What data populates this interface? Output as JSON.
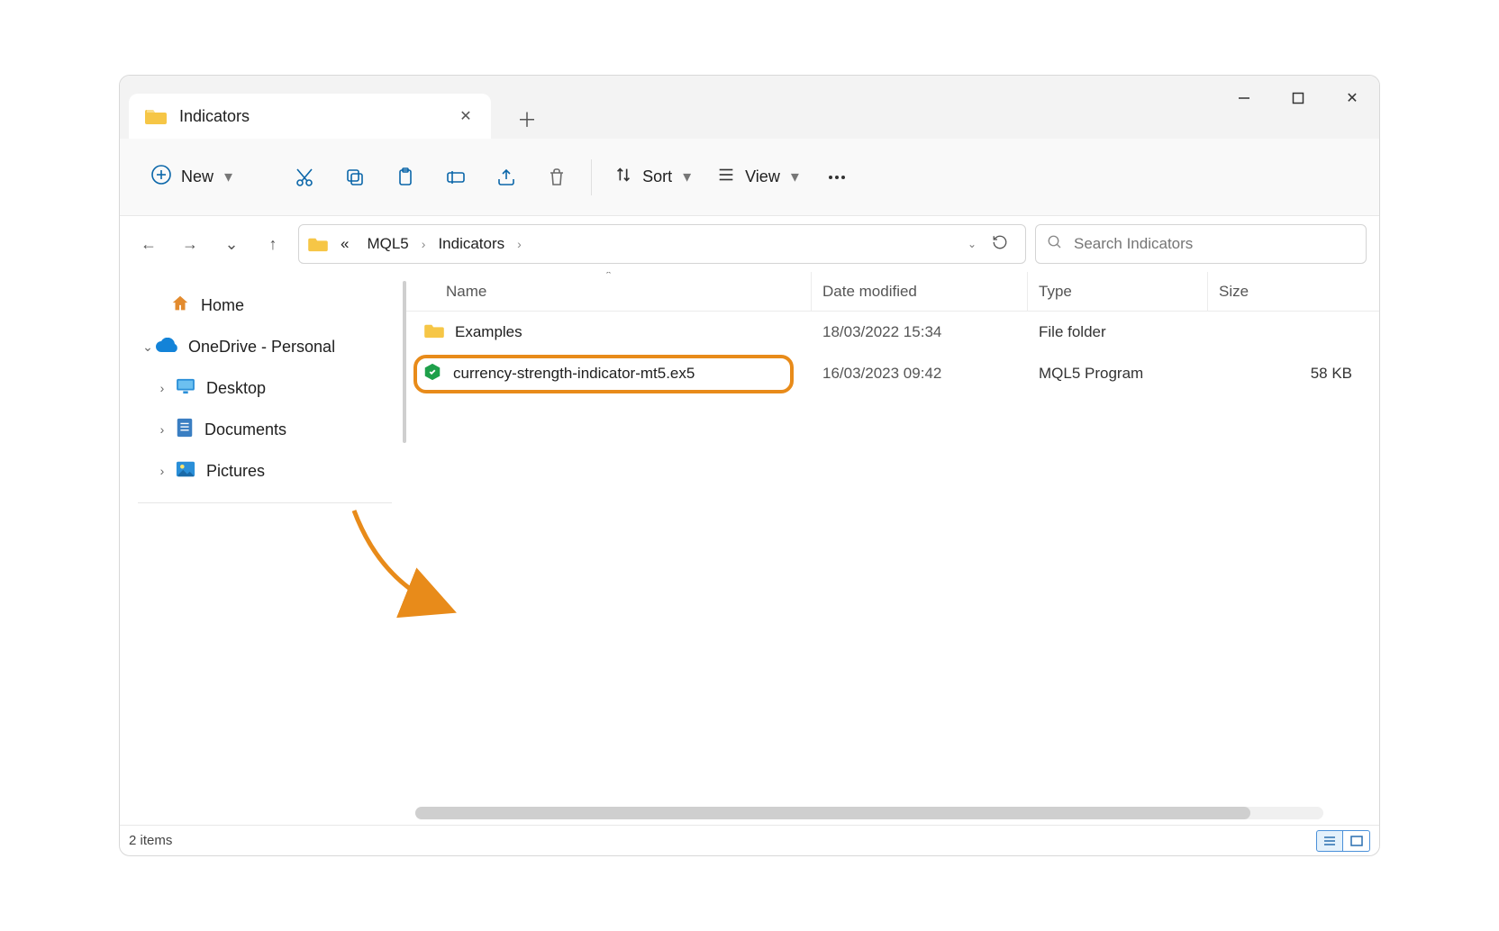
{
  "tab": {
    "title": "Indicators"
  },
  "toolbar": {
    "new_label": "New",
    "sort_label": "Sort",
    "view_label": "View"
  },
  "breadcrumb": {
    "prefix": "«",
    "parts": [
      "MQL5",
      "Indicators"
    ]
  },
  "search": {
    "placeholder": "Search Indicators"
  },
  "sidebar": {
    "home": "Home",
    "onedrive": "OneDrive - Personal",
    "desktop": "Desktop",
    "documents": "Documents",
    "pictures": "Pictures"
  },
  "columns": {
    "name": "Name",
    "date": "Date modified",
    "type": "Type",
    "size": "Size"
  },
  "rows": [
    {
      "name": "Examples",
      "date": "18/03/2022 15:34",
      "type": "File folder",
      "size": ""
    },
    {
      "name": "currency-strength-indicator-mt5.ex5",
      "date": "16/03/2023 09:42",
      "type": "MQL5 Program",
      "size": "58 KB"
    }
  ],
  "status": {
    "items": "2 items"
  }
}
